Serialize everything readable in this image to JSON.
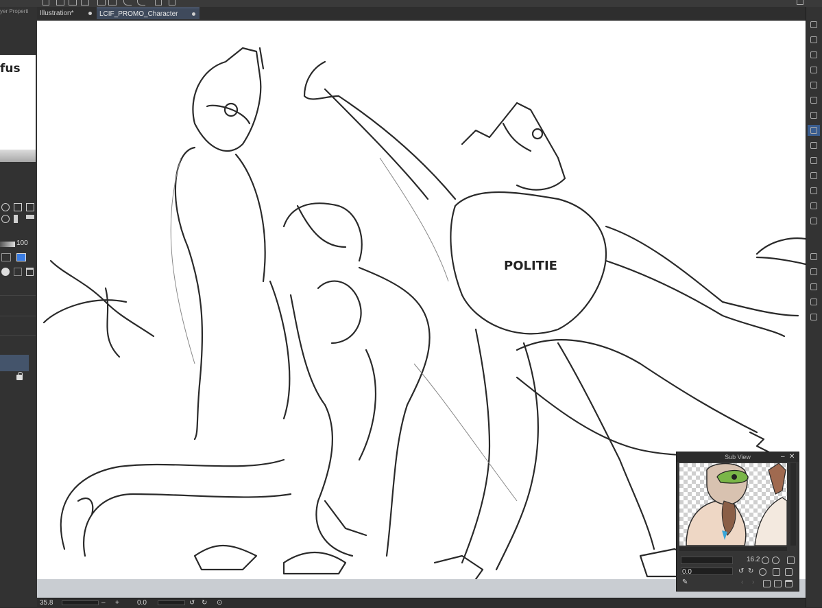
{
  "window": {
    "tabs": [
      {
        "label": "Illustration*"
      },
      {
        "label": "LCIF_PROMO_Character Banner*"
      }
    ],
    "left_panel_cut_label": "yer Properti",
    "left_doc_fragment": "fus",
    "brush_size_value": "100"
  },
  "canvas": {
    "sketch_text": "POLITIE"
  },
  "subview": {
    "title": "Sub View",
    "zoom_value": "16.2",
    "angle_value": "0.0"
  },
  "status": {
    "zoom": "35.8",
    "rotation": "0.0"
  },
  "colors": {
    "accent": "#6d87b3",
    "canvas": "#ffffff",
    "panel": "#323232"
  }
}
